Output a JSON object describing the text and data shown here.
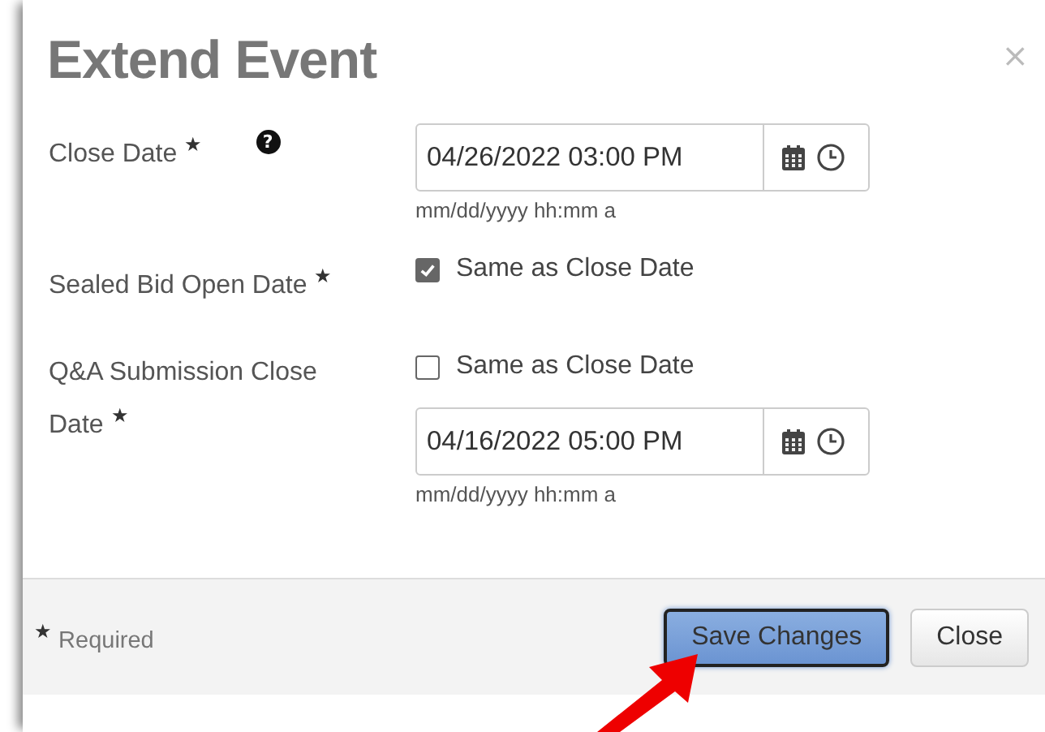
{
  "dialog": {
    "title": "Extend Event",
    "close_icon": "×"
  },
  "fields": [
    {
      "kind": "datetime",
      "label": "Close Date",
      "required_mark": "★",
      "help_icon": "?",
      "value": "04/26/2022 03:00 PM",
      "hint": "mm/dd/yyyy hh:mm a"
    },
    {
      "kind": "checkbox",
      "label": "Sealed Bid Open Date",
      "required_mark": "★",
      "checkbox": {
        "label": "Same as Close Date",
        "checked": true
      }
    },
    {
      "kind": "checkbox_datetime",
      "label": "Q&A Submission Close Date",
      "required_mark": "★",
      "checkbox": {
        "label": "Same as Close Date",
        "checked": false
      },
      "value": "04/16/2022 05:00 PM",
      "hint": "mm/dd/yyyy hh:mm a"
    }
  ],
  "footer": {
    "required_mark": "★",
    "required_note": "Required",
    "buttons": [
      {
        "label": "Save Changes",
        "kind": "primary"
      },
      {
        "label": "Close",
        "kind": "default"
      }
    ]
  }
}
